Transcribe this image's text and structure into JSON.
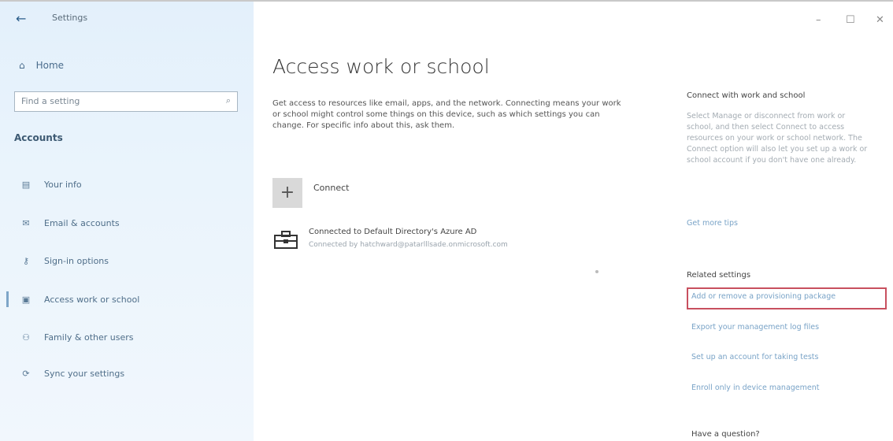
{
  "window": {
    "title": "Settings",
    "controls": [
      "–",
      "☐",
      "✕"
    ]
  },
  "sidebar": {
    "home_label": "Home",
    "search_placeholder": "Find a setting",
    "section_label": "Accounts",
    "items": [
      {
        "label": "Your info",
        "icon": "person-card-icon",
        "glyph": "▤"
      },
      {
        "label": "Email & accounts",
        "icon": "mail-icon",
        "glyph": "✉"
      },
      {
        "label": "Sign-in options",
        "icon": "key-icon",
        "glyph": "⚷"
      },
      {
        "label": "Access work or school",
        "icon": "briefcase-icon",
        "glyph": "▣",
        "active": true
      },
      {
        "label": "Family & other users",
        "icon": "people-icon",
        "glyph": "⚇"
      },
      {
        "label": "Sync your settings",
        "icon": "sync-icon",
        "glyph": "⟳"
      }
    ]
  },
  "main": {
    "title": "Access work or school",
    "description": "Get access to resources like email, apps, and the network. Connecting means your work or school might control some things on this device, such as which settings you can change. For specific info about this, ask them.",
    "connect_label": "Connect",
    "account": {
      "title": "Connected to Default Directory's Azure AD",
      "subtitle": "Connected by hatchward@patarlllsade.onmicrosoft.com"
    }
  },
  "right": {
    "connect_heading": "Connect with work and school",
    "connect_text": "Select Manage or disconnect from work or school, and then select Connect to access resources on your work or school network. The Connect option will also let you set up a work or school account if you don't have one already.",
    "tips_link": "Get more tips",
    "related_heading": "Related settings",
    "related_links": [
      "Add or remove a provisioning package",
      "Export your management log files",
      "Set up an account for taking tests",
      "Enroll only in device management"
    ],
    "question_heading": "Have a question?"
  },
  "colors": {
    "highlight_border": "#c8505f",
    "link": "#79a3c7",
    "sidebar_bg": "#e6f2fb"
  }
}
